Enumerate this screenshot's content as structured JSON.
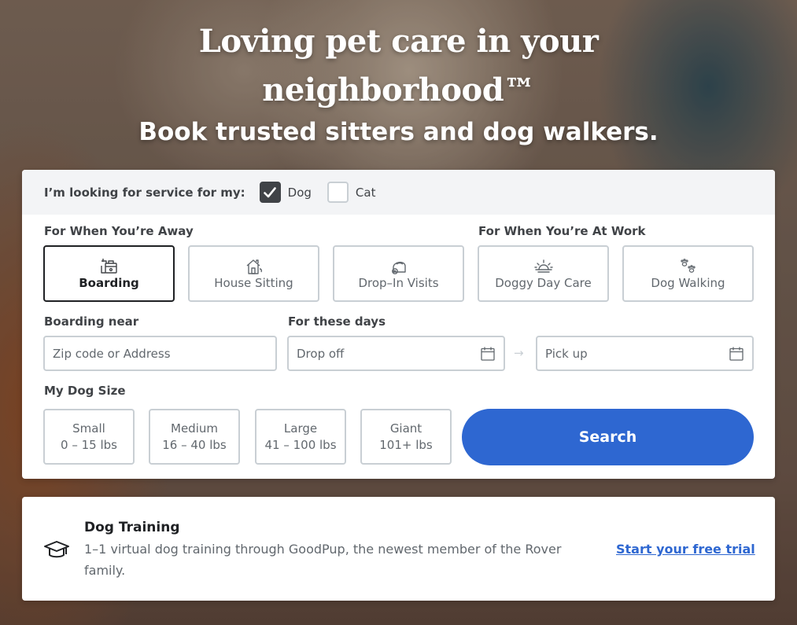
{
  "hero": {
    "title_line1": "Loving pet care in your",
    "title_line2": "neighborhood™",
    "subtitle": "Book trusted sitters and dog walkers."
  },
  "pet_selector": {
    "prompt": "I’m looking for service for my:",
    "options": [
      {
        "label": "Dog",
        "checked": true
      },
      {
        "label": "Cat",
        "checked": false
      }
    ]
  },
  "services": {
    "away_label": "For When You’re Away",
    "work_label": "For When You’re At Work",
    "items": [
      {
        "label": "Boarding",
        "icon": "boarding-icon",
        "selected": true
      },
      {
        "label": "House Sitting",
        "icon": "house-icon",
        "selected": false
      },
      {
        "label": "Drop–In Visits",
        "icon": "food-bowl-icon",
        "selected": false
      },
      {
        "label": "Doggy Day Care",
        "icon": "sun-icon",
        "selected": false
      },
      {
        "label": "Dog Walking",
        "icon": "paw-prints-icon",
        "selected": false
      }
    ]
  },
  "location": {
    "label": "Boarding near",
    "placeholder": "Zip code or Address"
  },
  "dates": {
    "label": "For these days",
    "dropoff_placeholder": "Drop off",
    "pickup_placeholder": "Pick up",
    "arrow": "→"
  },
  "dog_size": {
    "label": "My Dog Size",
    "options": [
      {
        "name": "Small",
        "range": "0 – 15 lbs"
      },
      {
        "name": "Medium",
        "range": "16 – 40 lbs"
      },
      {
        "name": "Large",
        "range": "41 – 100 lbs"
      },
      {
        "name": "Giant",
        "range": "101+ lbs"
      }
    ]
  },
  "search_button": "Search",
  "training": {
    "title": "Dog Training",
    "description": "1–1 virtual dog training through GoodPup, the newest member of the Rover family.",
    "link": "Start your free trial",
    "icon": "graduation-cap-icon"
  },
  "colors": {
    "accent": "#2e67d1",
    "text_dark": "#404347",
    "border": "#c9cfd4"
  }
}
